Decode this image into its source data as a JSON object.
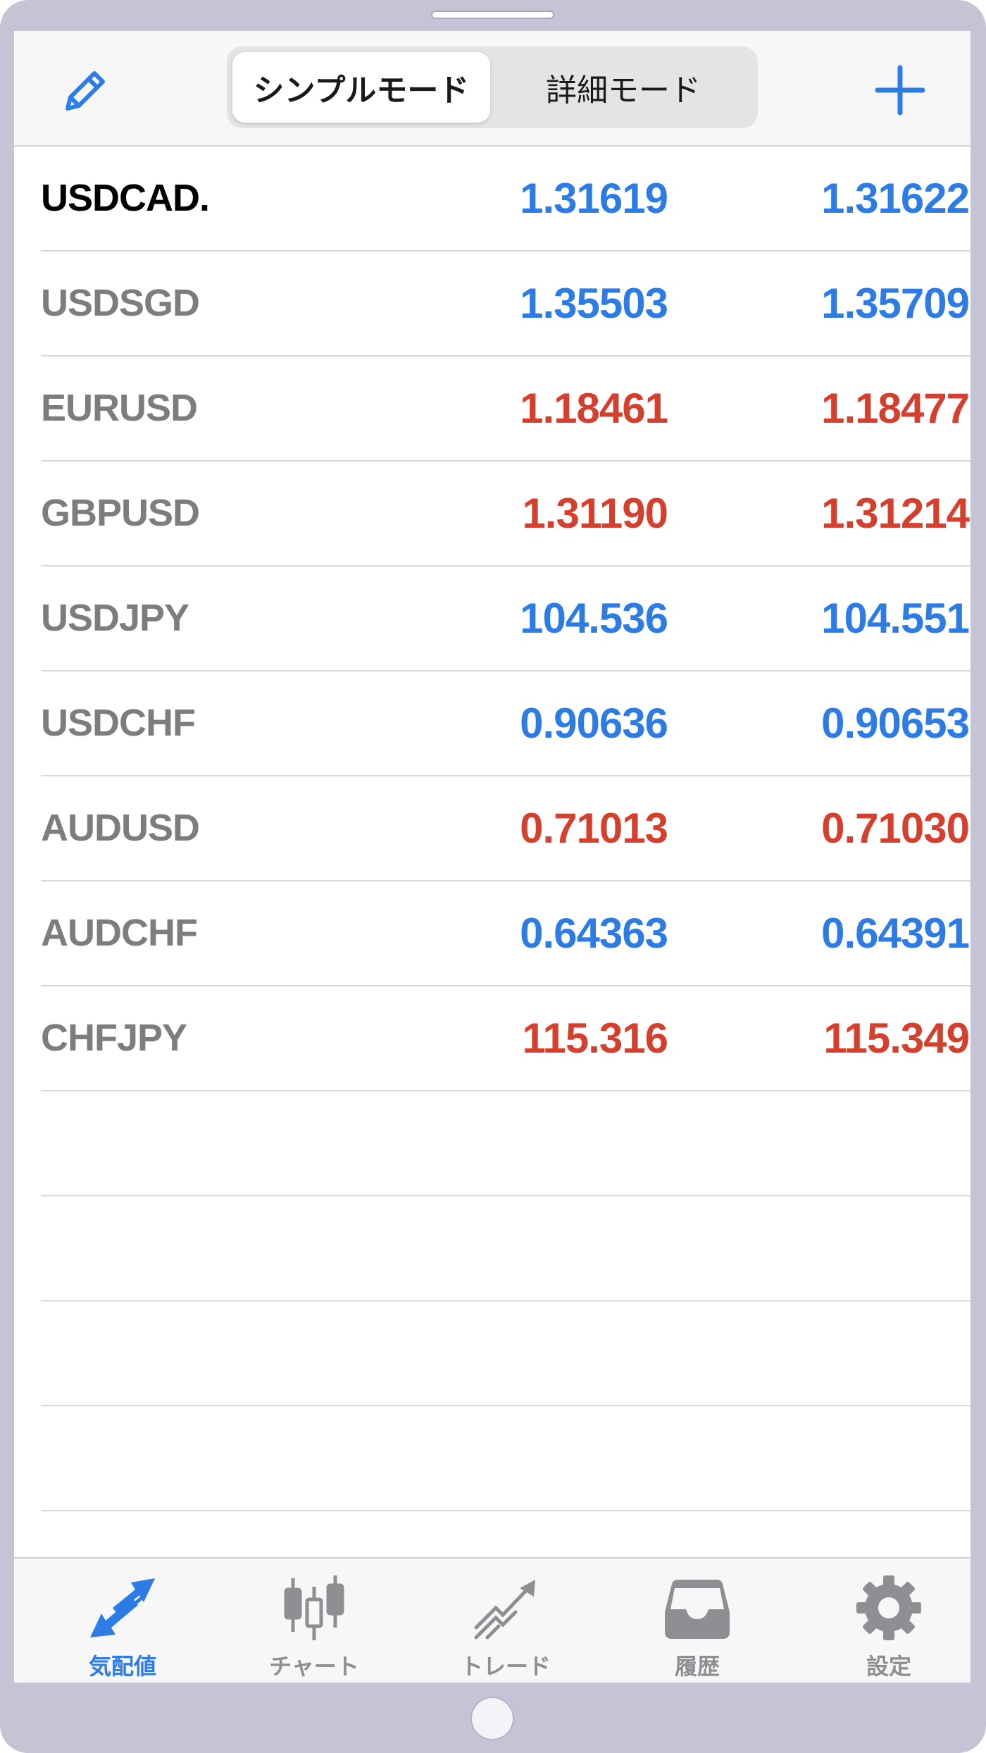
{
  "header": {
    "tabs": [
      {
        "label": "シンプルモード",
        "active": true
      },
      {
        "label": "詳細モード",
        "active": false
      }
    ],
    "edit_icon": "pencil-icon",
    "add_icon": "plus-icon"
  },
  "colors": {
    "up": "#2d7be5",
    "down": "#d43f2e",
    "accent": "#2d7be5"
  },
  "quotes": [
    {
      "symbol": "USDCAD.",
      "bid": "1.31619",
      "ask": "1.31622",
      "direction": "up",
      "selected": true
    },
    {
      "symbol": "USDSGD",
      "bid": "1.35503",
      "ask": "1.35709",
      "direction": "up"
    },
    {
      "symbol": "EURUSD",
      "bid": "1.18461",
      "ask": "1.18477",
      "direction": "down"
    },
    {
      "symbol": "GBPUSD",
      "bid": "1.31190",
      "ask": "1.31214",
      "direction": "down"
    },
    {
      "symbol": "USDJPY",
      "bid": "104.536",
      "ask": "104.551",
      "direction": "up"
    },
    {
      "symbol": "USDCHF",
      "bid": "0.90636",
      "ask": "0.90653",
      "direction": "up"
    },
    {
      "symbol": "AUDUSD",
      "bid": "0.71013",
      "ask": "0.71030",
      "direction": "down"
    },
    {
      "symbol": "AUDCHF",
      "bid": "0.64363",
      "ask": "0.64391",
      "direction": "up"
    },
    {
      "symbol": "CHFJPY",
      "bid": "115.316",
      "ask": "115.349",
      "direction": "down"
    }
  ],
  "tabbar": [
    {
      "label": "気配値",
      "icon": "quotes-arrows-icon",
      "active": true
    },
    {
      "label": "チャート",
      "icon": "candlestick-icon",
      "active": false
    },
    {
      "label": "トレード",
      "icon": "trade-trend-icon",
      "active": false
    },
    {
      "label": "履歴",
      "icon": "inbox-tray-icon",
      "active": false
    },
    {
      "label": "設定",
      "icon": "gear-icon",
      "active": false
    }
  ]
}
